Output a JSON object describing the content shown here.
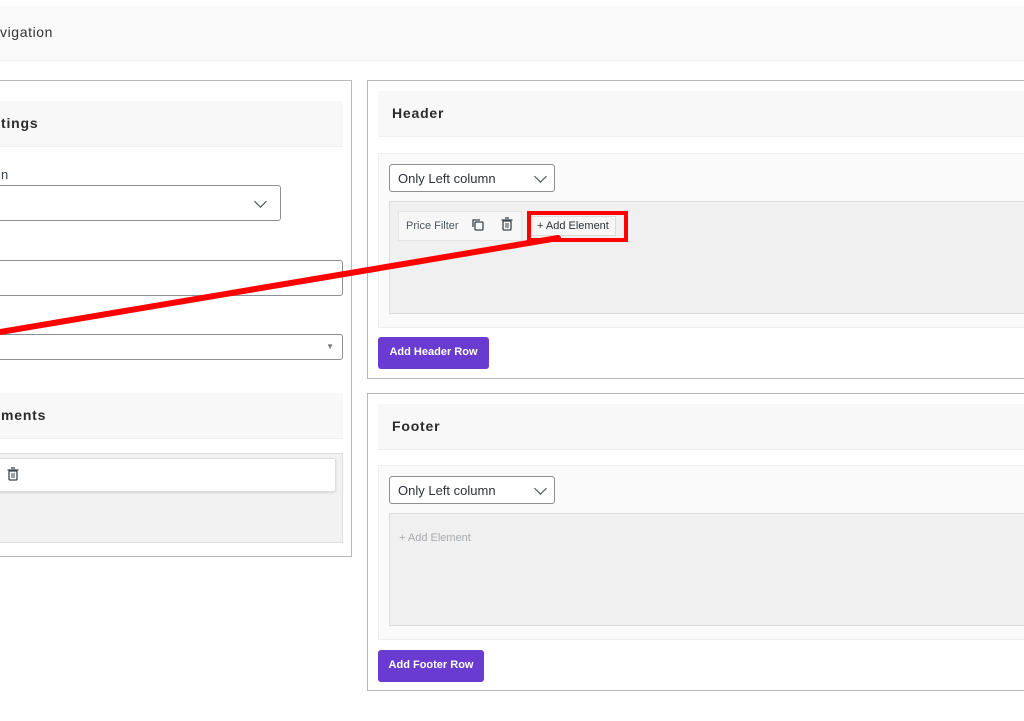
{
  "topbar": {
    "title": "vigation"
  },
  "left_panel": {
    "settings_heading": "tings",
    "field_label_fragment": "n",
    "elements_heading": "ments"
  },
  "header_section": {
    "title": "Header",
    "column_select": "Only Left column",
    "element_chip": "Price Filter",
    "add_element": "+ Add Element",
    "add_row_button": "Add Header Row"
  },
  "footer_section": {
    "title": "Footer",
    "column_select": "Only Left column",
    "add_element_placeholder": "+ Add Element",
    "add_row_button": "Add Footer Row"
  },
  "colors": {
    "accent": "#6a3bd0",
    "annotation": "#ff0000"
  },
  "icons": [
    "copy-icon",
    "trash-icon",
    "chevron-down-icon"
  ]
}
